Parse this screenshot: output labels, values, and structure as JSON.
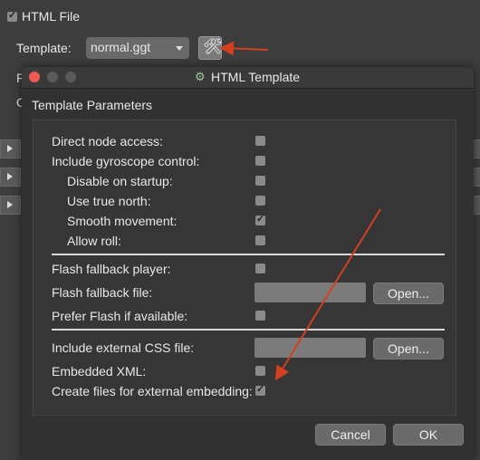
{
  "background_panel": {
    "html_file_label": "HTML File",
    "template_label": "Template:",
    "template_value": "normal.ggt",
    "hidden_label_f": "F",
    "hidden_label_o": "O"
  },
  "dialog": {
    "title": "HTML Template",
    "section_title": "Template Parameters",
    "params": {
      "direct_node_access": "Direct node access:",
      "include_gyroscope": "Include gyroscope control:",
      "disable_on_startup": "Disable on startup:",
      "use_true_north": "Use true north:",
      "smooth_movement": "Smooth movement:",
      "allow_roll": "Allow roll:",
      "flash_fallback_player": "Flash fallback player:",
      "flash_fallback_file": "Flash fallback file:",
      "prefer_flash": "Prefer Flash if available:",
      "include_css": "Include external CSS file:",
      "embedded_xml": "Embedded XML:",
      "create_files": "Create files for external embedding:"
    },
    "open_label": "Open...",
    "cancel_label": "Cancel",
    "ok_label": "OK"
  },
  "colors": {
    "annotation_arrow": "#d2401e",
    "dialog_bg": "#323232",
    "panel_bg": "#3d3d3d"
  }
}
